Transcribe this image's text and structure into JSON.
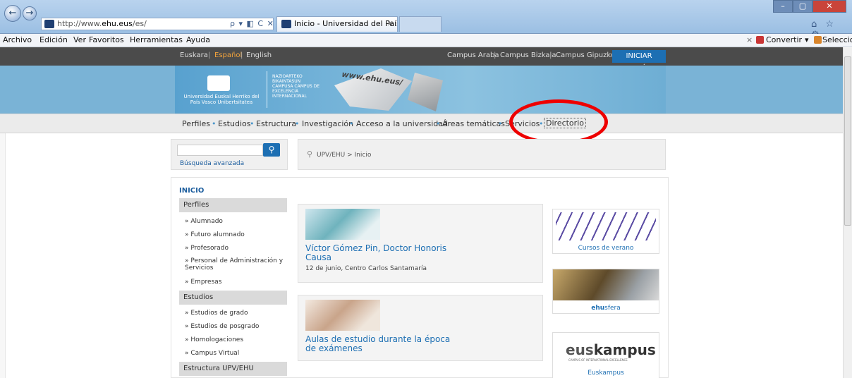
{
  "browser": {
    "address_plain": "http://www.",
    "address_domain": "ehu.eus",
    "address_path": "/es/",
    "address_tools": "ρ ▾ ◧ C ✕",
    "tab_title": "Inicio - Universidad del País...",
    "tab_close": "✕",
    "back_symbol": "←",
    "forward_symbol": "→",
    "min_symbol": "–",
    "max_symbol": "▢",
    "close_symbol": "✕",
    "right_icons": "⌂ ☆ ⚙"
  },
  "menubar": {
    "items": [
      "Archivo",
      "Edición",
      "Ver",
      "Favoritos",
      "Herramientas",
      "Ayuda"
    ],
    "right_close": "×",
    "convert_label": "Convertir",
    "convert_arrow": "▾",
    "select_label": "Seleccionar"
  },
  "topbar": {
    "lang_eu": "Euskara",
    "lang_es": "Español",
    "lang_en": "English",
    "sep": "|",
    "campus_araba": "Campus Araba",
    "campus_bizkaia": "Campus Bizkaia",
    "campus_gipuzkoa": "Campus Gipuzkoa",
    "login": "INICIAR SESIÓN"
  },
  "banner": {
    "logo_text": "Universidad   Euskal Herriko del País Vasco   Unibertsitatea",
    "campus_text": "NAZIOARTEKO BIKAINTASUN CAMPUSA CAMPUS DE EXCELENCIA INTERNACIONAL",
    "url_text": "www.ehu.eus/"
  },
  "mainnav": {
    "items": [
      "Perfiles",
      "Estudios",
      "Estructura",
      "Investigación",
      "Acceso a la universidad",
      "Áreas temáticas",
      "Servicios",
      "Directorio"
    ],
    "dot": "•"
  },
  "search": {
    "placeholder": "",
    "button_icon": "⚲",
    "advanced": "Búsqueda avanzada"
  },
  "breadcrumb": {
    "pin_icon": "⚲",
    "text": "UPV/EHU > Inicio"
  },
  "sidebar": {
    "inicio": "INICIO",
    "perfiles_head": "Perfiles",
    "perfiles_items": [
      "» Alumnado",
      "» Futuro alumnado",
      "» Profesorado",
      "» Personal de Administración y Servicios",
      "» Empresas"
    ],
    "estudios_head": "Estudios",
    "estudios_items": [
      "» Estudios de grado",
      "» Estudios de posgrado",
      "» Homologaciones",
      "» Campus Virtual"
    ],
    "estructura_head": "Estructura UPV/EHU"
  },
  "news": [
    {
      "title": "Víctor Gómez Pin, Doctor Honoris Causa",
      "subtitle": "12 de junio, Centro Carlos Santamaría"
    },
    {
      "title": "Aulas de estudio durante la época de exámenes",
      "subtitle": ""
    }
  ],
  "promos": {
    "cursos": "Cursos de verano",
    "ehusfera_bold": "ehu",
    "ehusfera_rest": "sfera",
    "euskampus_logo_a": "eus",
    "euskampus_logo_b": "kampus",
    "euskampus_tag": "CAMPUS OF INTERNATIONAL EXCELLENCE",
    "euskampus": "Euskampus"
  },
  "colors": {
    "accent": "#1d6fb3",
    "highlight": "#ee0000",
    "topbar": "#4b4b4b",
    "banner": "#7ab3d6"
  }
}
